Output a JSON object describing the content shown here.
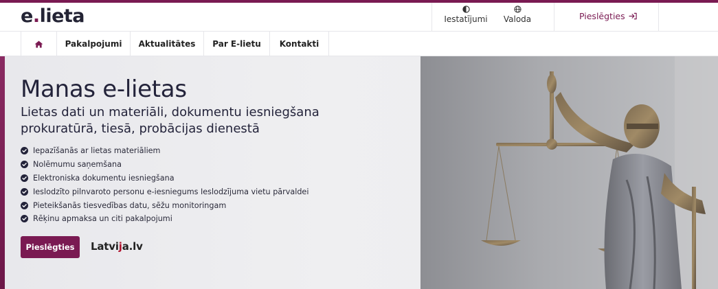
{
  "logo": {
    "part1": "e",
    "dot": ".",
    "part2": "lieta"
  },
  "header": {
    "settings_label": "Iestatījumi",
    "language_label": "Valoda",
    "login_label": "Pieslēgties"
  },
  "nav": {
    "items": [
      {
        "label": "Pakalpojumi"
      },
      {
        "label": "Aktualitātes"
      },
      {
        "label": "Par E-lietu"
      },
      {
        "label": "Kontakti"
      }
    ]
  },
  "hero": {
    "title": "Manas e-lietas",
    "subtitle_line1": "Lietas dati un materiāli, dokumentu iesniegšana",
    "subtitle_line2": "prokuratūrā, tiesā, probācijas dienestā",
    "features": [
      "Iepazīšanās ar lietas materiāliem",
      "Nolēmumu saņemšana",
      "Elektroniska dokumentu iesniegšana",
      "Ieslodzīto pilnvaroto personu e-iesniegums Ieslodzījuma vietu pārvaldei",
      "Pieteikšanās tiesvedības datu, sēžu monitoringam",
      "Rēķinu apmaksa un citi pakalpojumi"
    ],
    "cta_label": "Pieslēgties",
    "partner_logo": {
      "part1": "Latvi",
      "accent": "j",
      "part2": "a.lv"
    }
  },
  "icons": {
    "settings": "contrast-icon",
    "language": "globe-icon",
    "login": "login-arrow-icon",
    "home": "home-icon",
    "check": "check-circle-icon"
  },
  "colors": {
    "brand": "#7a1a52",
    "text": "#23233a",
    "hero_bg": "#ececef"
  }
}
